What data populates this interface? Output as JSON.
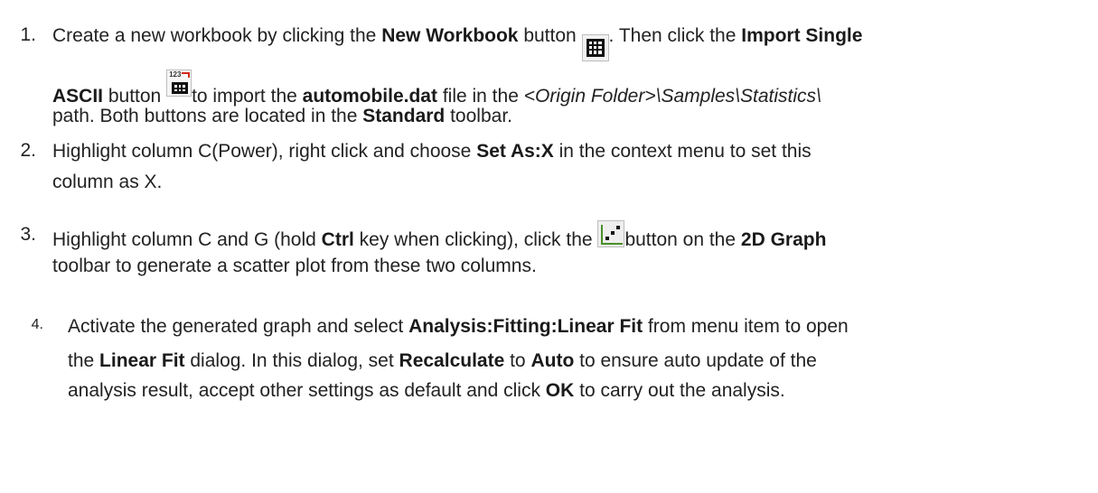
{
  "steps": [
    {
      "number": "1.",
      "t1": "Create a new workbook by clicking the ",
      "b1": "New Workbook",
      "t2": " button ",
      "t3": ". Then click the ",
      "b2": "Import Single",
      "b3": "ASCII",
      "t4": " button ",
      "t5": "to import the ",
      "b4": "automobile.dat",
      "t6": " file in the ",
      "i1": "<Origin Folder>\\Samples\\Statistics\\",
      "t7": "path. Both buttons are located in the ",
      "b5": "Standard",
      "t8": " toolbar."
    },
    {
      "number": "2.",
      "t1": "Highlight column C(Power), right click and choose ",
      "b1": "Set As:X",
      "t2": " in the context menu to set this",
      "t3": "column as X."
    },
    {
      "number": "3.",
      "t1": "Highlight column C and G (hold ",
      "b1": "Ctrl",
      "t2": " key when clicking), click the ",
      "t3": "button on the ",
      "b2": "2D Graph",
      "t4": "toolbar to generate a scatter plot from these two columns."
    },
    {
      "number": "4.",
      "t1": "Activate the generated graph and select ",
      "b1": "Analysis:Fitting:Linear Fit",
      "t2": " from menu item to open",
      "t3": "the ",
      "b2": "Linear Fit",
      "t4": " dialog. In this dialog, set ",
      "b3": "Recalculate",
      "t5": " to ",
      "b4": "Auto",
      "t6": " to ensure auto update of the",
      "t7": "analysis result, accept other settings as default and click ",
      "b5": "OK",
      "t8": " to carry out the analysis."
    }
  ],
  "icons": {
    "new_workbook": "new-workbook-icon",
    "import_ascii": "import-single-ascii-icon",
    "import_badge": "123",
    "scatter": "scatter-plot-icon"
  }
}
